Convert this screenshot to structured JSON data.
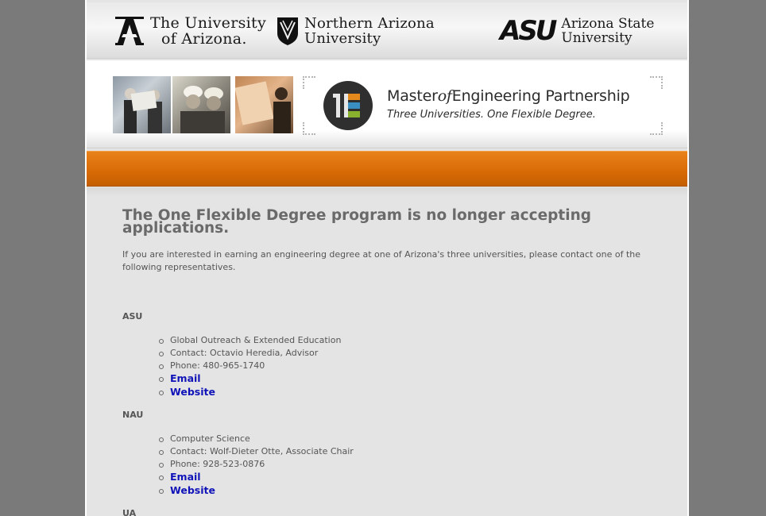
{
  "universities": {
    "ua": {
      "line1": "The University",
      "line2": "of Arizona."
    },
    "nau": {
      "line1": "Northern Arizona",
      "line2": "University"
    },
    "asu": {
      "mark": "ASU",
      "line1": "Arizona State",
      "line2": "University"
    }
  },
  "banner": {
    "logo_letters": "1E",
    "title_part1": "Master",
    "title_of": "of",
    "title_part2": "Engineering Partnership",
    "tagline": "Three Universities. One Flexible Degree."
  },
  "content": {
    "headline": "The One Flexible Degree program is no longer accepting applications.",
    "intro": "If you are interested in earning an engineering degree at one of Arizona's three universities, please contact one of the following representatives.",
    "groups": [
      {
        "label": "ASU",
        "items": [
          "Global Outreach & Extended Education",
          "Contact: Octavio Heredia, Advisor",
          "Phone: 480-965-1740"
        ],
        "links": [
          "Email",
          "Website"
        ]
      },
      {
        "label": "NAU",
        "items": [
          "Computer Science",
          "Contact: Wolf-Dieter Otte, Associate Chair",
          "Phone: 928-523-0876"
        ],
        "links": [
          "Email",
          "Website"
        ]
      },
      {
        "label": "UA"
      }
    ]
  },
  "colors": {
    "background": "#7a7a7a",
    "orange_bar": "#d86a04",
    "link": "#1014b8",
    "text": "#555555"
  }
}
